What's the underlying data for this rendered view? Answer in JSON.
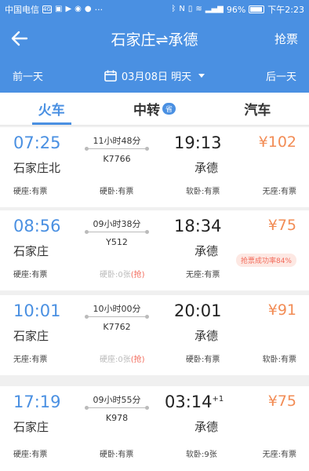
{
  "status": {
    "carrier": "中国电信",
    "icons_left": [
      "4G",
      "notification-icon",
      "play-icon",
      "wechat-icon",
      "chat-icon"
    ],
    "more": "···",
    "battery": "96%",
    "time": "下午2:23"
  },
  "nav": {
    "title": "石家庄⇌承德",
    "right_label": "抢票"
  },
  "date_bar": {
    "prev": "前一天",
    "current": "03月08日 明天",
    "next": "后一天"
  },
  "tabs": [
    {
      "label": "火车",
      "active": true
    },
    {
      "label": "中转",
      "badge": "省"
    },
    {
      "label": "汽车"
    }
  ],
  "colors": {
    "accent": "#4a90e2",
    "price": "#f28c55",
    "grab": "#f26a5a"
  },
  "trains": [
    {
      "dep_time": "07:25",
      "dep_station": "石家庄北",
      "duration": "11小时48分",
      "train_no": "K7766",
      "arr_time": "19:13",
      "arr_plus": "",
      "arr_station": "承德",
      "price": "¥102",
      "note": "",
      "seats": [
        {
          "text": "硬座:有票",
          "grab": "",
          "muted": false
        },
        {
          "text": "硬卧:有票",
          "grab": "",
          "muted": false
        },
        {
          "text": "软卧:有票",
          "grab": "",
          "muted": false
        },
        {
          "text": "无座:有票",
          "grab": "",
          "muted": false
        }
      ]
    },
    {
      "dep_time": "08:56",
      "dep_station": "石家庄",
      "duration": "09小时38分",
      "train_no": "Y512",
      "arr_time": "18:34",
      "arr_plus": "",
      "arr_station": "承德",
      "price": "¥75",
      "note": "抢票成功率84%",
      "seats": [
        {
          "text": "硬座:有票",
          "grab": "",
          "muted": false
        },
        {
          "text": "硬卧:0张",
          "grab": "(抢)",
          "muted": true
        },
        {
          "text": "无座:有票",
          "grab": "",
          "muted": false
        }
      ]
    },
    {
      "dep_time": "10:01",
      "dep_station": "石家庄",
      "duration": "10小时00分",
      "train_no": "K7762",
      "arr_time": "20:01",
      "arr_plus": "",
      "arr_station": "承德",
      "price": "¥91",
      "note": "",
      "seats": [
        {
          "text": "无座:有票",
          "grab": "",
          "muted": false
        },
        {
          "text": "硬座:0张",
          "grab": "(抢)",
          "muted": true
        },
        {
          "text": "硬卧:有票",
          "grab": "",
          "muted": false
        },
        {
          "text": "软卧:有票",
          "grab": "",
          "muted": false
        }
      ]
    },
    {
      "dep_time": "17:19",
      "dep_station": "石家庄",
      "duration": "09小时55分",
      "train_no": "K978",
      "arr_time": "03:14",
      "arr_plus": "+1",
      "arr_station": "承德",
      "price": "¥75",
      "note": "",
      "seats": [
        {
          "text": "硬座:有票",
          "grab": "",
          "muted": false
        },
        {
          "text": "硬卧:有票",
          "grab": "",
          "muted": false
        },
        {
          "text": "软卧:9张",
          "grab": "",
          "muted": false
        },
        {
          "text": "无座:有票",
          "grab": "",
          "muted": false
        }
      ]
    }
  ]
}
